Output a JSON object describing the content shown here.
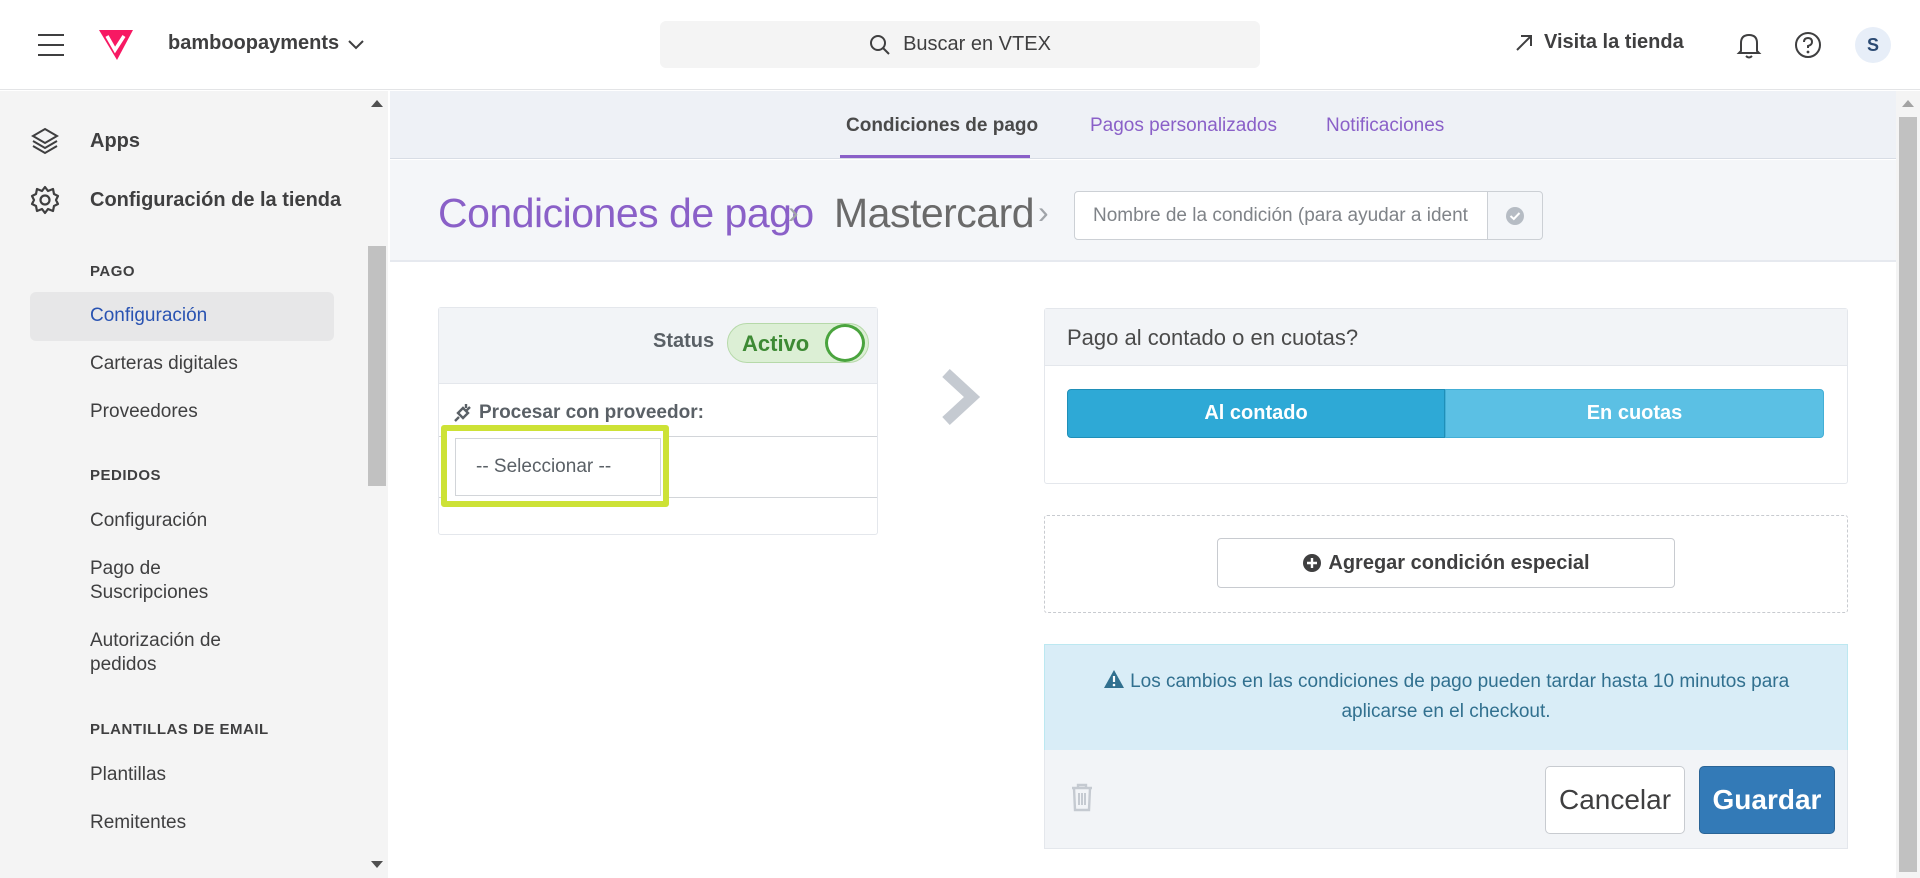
{
  "topbar": {
    "account_name": "bamboopayments",
    "search_placeholder": "Buscar en VTEX",
    "visit_store": "Visita la tienda",
    "avatar_initial": "S"
  },
  "sidebar": {
    "apps_label": "Apps",
    "store_config_label": "Configuración de la tienda",
    "sections": [
      {
        "title": "PAGO",
        "items": [
          "Configuración",
          "Carteras digitales",
          "Proveedores"
        ]
      },
      {
        "title": "PEDIDOS",
        "items": [
          "Configuración",
          "Pago de Suscripciones",
          "Autorización de pedidos"
        ]
      },
      {
        "title": "PLANTILLAS DE EMAIL",
        "items": [
          "Plantillas",
          "Remitentes"
        ]
      }
    ],
    "active_item": "Configuración"
  },
  "tabs": [
    {
      "label": "Condiciones de pago",
      "active": true
    },
    {
      "label": "Pagos personalizados",
      "active": false
    },
    {
      "label": "Notificaciones",
      "active": false
    }
  ],
  "breadcrumb": {
    "root": "Condiciones de pago",
    "current": "Mastercard",
    "name_placeholder": "Nombre de la condición (para ayudar a identificar)"
  },
  "condition": {
    "status_label": "Status",
    "status_value": "Activo",
    "provider_label": "Procesar con proveedor:",
    "provider_select": "-- Seleccionar --"
  },
  "payment": {
    "question": "Pago al contado o en cuotas?",
    "option_cash": "Al contado",
    "option_installments": "En cuotas"
  },
  "special": {
    "add_label": "Agregar condición especial"
  },
  "notice": {
    "text": "Los cambios en las condiciones de pago pueden tardar hasta 10 minutos para aplicarse en el checkout."
  },
  "actions": {
    "cancel": "Cancelar",
    "save": "Guardar"
  },
  "colors": {
    "brand": "#f71963",
    "accent_purple": "#8a60c8",
    "primary_blue": "#337ab7",
    "cyan": "#2ea9d6",
    "highlight": "#cde236"
  }
}
